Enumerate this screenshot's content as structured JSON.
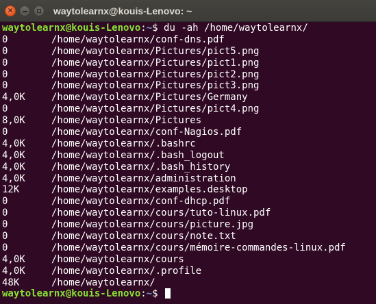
{
  "window": {
    "title": "waytolearnx@kouis-Lenovo: ~",
    "close_glyph": "×"
  },
  "prompt": {
    "user_host": "waytolearnx@kouis-Lenovo",
    "separator": ":",
    "path": "~",
    "symbol": "$ "
  },
  "command": "du -ah /home/waytolearnx/",
  "output": [
    {
      "size": "0",
      "path": "/home/waytolearnx/conf-dns.pdf"
    },
    {
      "size": "0",
      "path": "/home/waytolearnx/Pictures/pict5.png"
    },
    {
      "size": "0",
      "path": "/home/waytolearnx/Pictures/pict1.png"
    },
    {
      "size": "0",
      "path": "/home/waytolearnx/Pictures/pict2.png"
    },
    {
      "size": "0",
      "path": "/home/waytolearnx/Pictures/pict3.png"
    },
    {
      "size": "4,0K",
      "path": "/home/waytolearnx/Pictures/Germany"
    },
    {
      "size": "0",
      "path": "/home/waytolearnx/Pictures/pict4.png"
    },
    {
      "size": "8,0K",
      "path": "/home/waytolearnx/Pictures"
    },
    {
      "size": "0",
      "path": "/home/waytolearnx/conf-Nagios.pdf"
    },
    {
      "size": "4,0K",
      "path": "/home/waytolearnx/.bashrc"
    },
    {
      "size": "4,0K",
      "path": "/home/waytolearnx/.bash_logout"
    },
    {
      "size": "4,0K",
      "path": "/home/waytolearnx/.bash_history"
    },
    {
      "size": "4,0K",
      "path": "/home/waytolearnx/administration"
    },
    {
      "size": "12K",
      "path": "/home/waytolearnx/examples.desktop"
    },
    {
      "size": "0",
      "path": "/home/waytolearnx/conf-dhcp.pdf"
    },
    {
      "size": "0",
      "path": "/home/waytolearnx/cours/tuto-linux.pdf"
    },
    {
      "size": "0",
      "path": "/home/waytolearnx/cours/picture.jpg"
    },
    {
      "size": "0",
      "path": "/home/waytolearnx/cours/note.txt"
    },
    {
      "size": "0",
      "path": "/home/waytolearnx/cours/mémoire-commandes-linux.pdf"
    },
    {
      "size": "4,0K",
      "path": "/home/waytolearnx/cours"
    },
    {
      "size": "4,0K",
      "path": "/home/waytolearnx/.profile"
    },
    {
      "size": "48K",
      "path": "/home/waytolearnx/"
    }
  ],
  "colors": {
    "background": "#300a24",
    "prompt_user": "#8ae234",
    "prompt_path": "#729fcf",
    "text": "#ffffff"
  },
  "icons": {
    "close": "close-icon",
    "minimize": "minimize-icon",
    "maximize": "maximize-icon"
  }
}
